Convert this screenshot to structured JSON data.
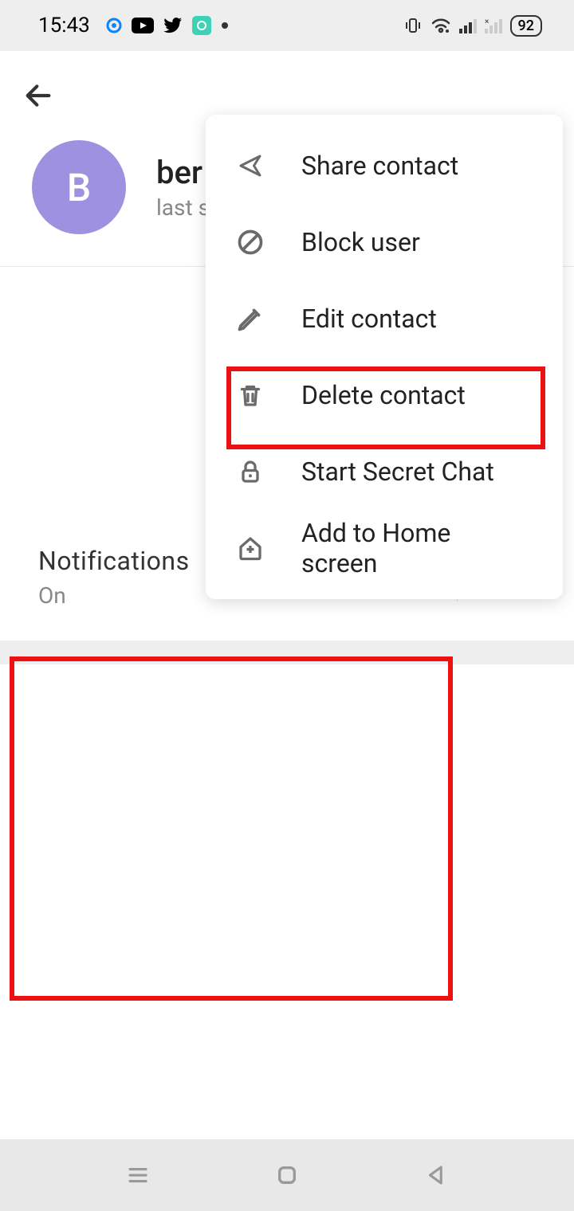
{
  "status_bar": {
    "time": "15:43",
    "battery": "92"
  },
  "profile": {
    "avatar_letter": "B",
    "name": "ber",
    "status": "last s"
  },
  "menu": {
    "items": [
      {
        "label": "Share contact"
      },
      {
        "label": "Block user"
      },
      {
        "label": "Edit contact"
      },
      {
        "label": "Delete contact"
      },
      {
        "label": "Start Secret Chat"
      },
      {
        "label": "Add to Home screen"
      }
    ]
  },
  "notifications": {
    "title": "Notifications",
    "value": "On"
  }
}
